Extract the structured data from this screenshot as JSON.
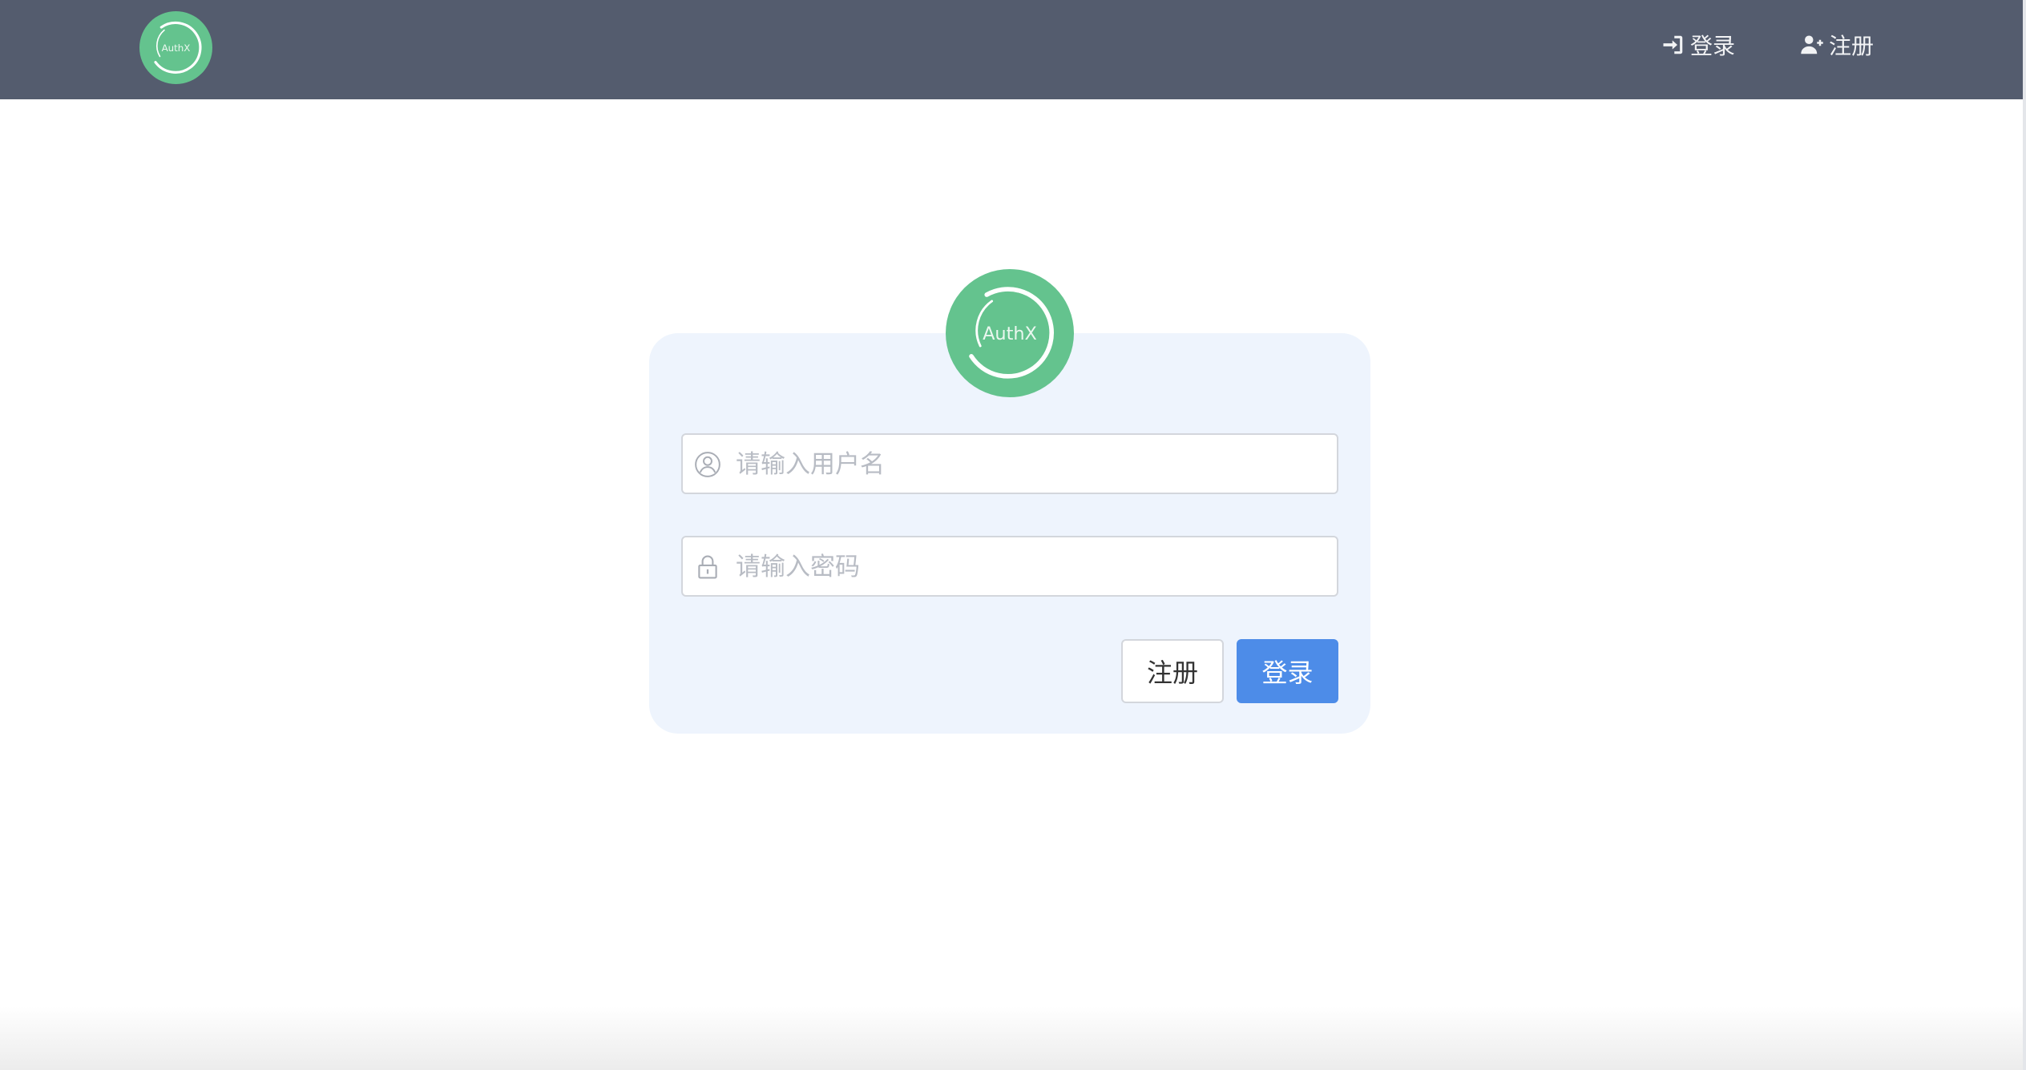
{
  "brand": {
    "logo_text": "AuthX",
    "logo_color": "#64c38e"
  },
  "navbar": {
    "background": "#545c6e",
    "login": {
      "icon": "sign-in-icon",
      "label": "登录"
    },
    "register": {
      "icon": "user-plus-icon",
      "label": "注册"
    }
  },
  "form": {
    "username": {
      "icon": "user-circle-icon",
      "placeholder": "请输入用户名",
      "value": ""
    },
    "password": {
      "icon": "lock-icon",
      "placeholder": "请输入密码",
      "value": ""
    },
    "register_button": "注册",
    "login_button": "登录",
    "primary_color": "#4d8ce8",
    "card_background": "#eef4fd"
  }
}
